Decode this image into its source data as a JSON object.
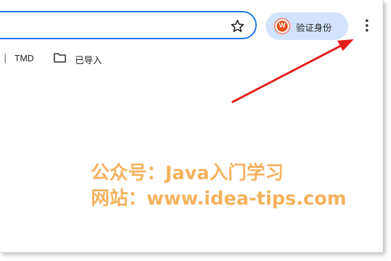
{
  "profile": {
    "avatar_letter": "W",
    "label": "验证身份"
  },
  "bookmarks": {
    "items": [
      {
        "label": "TMD"
      },
      {
        "label": "已导入",
        "icon": "folder-icon"
      }
    ]
  },
  "toolbar": {
    "star_icon": "star-icon",
    "menu_icon": "vertical-dots-menu-icon"
  },
  "annotation": {
    "arrow_color": "#e51c1c",
    "points_to": "menu-icon"
  },
  "watermark": {
    "line1": "公众号：Java入门学习",
    "line2": "网站：www.idea-tips.com",
    "color": "#f5b25d"
  },
  "colors": {
    "omnibox_border": "#1a73e8",
    "profile_chip_bg": "#d3e3fd",
    "avatar_bg": "#e8501c"
  }
}
